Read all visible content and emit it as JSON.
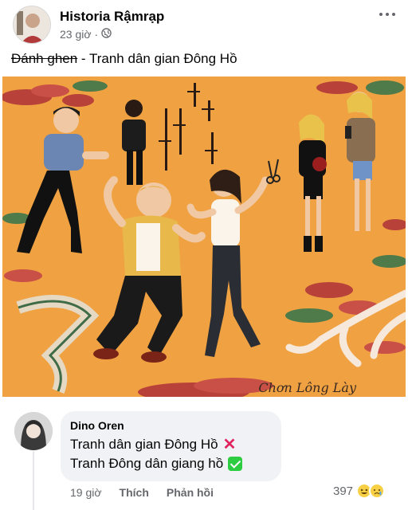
{
  "post": {
    "page_name": "Historia Rậmrạp",
    "time": "23 giờ",
    "audience_icon": "globe-icon",
    "more_icon": "more-options-icon",
    "caption_struck": "Đánh ghen",
    "caption_rest": " - Tranh dân gian Đông Hồ",
    "artwork": {
      "signature": "Chơn Lông Lày",
      "calligraphy_col1": "打從又相",
      "calligraphy_col2": "捉奸夕奸",
      "calligraphy_col3": "之調生事",
      "calligraphy_col4": "孫碩房屋"
    }
  },
  "comment": {
    "author": "Dino Oren",
    "line1": "Tranh dân gian Đông Hồ",
    "line1_icon": "cross-mark-icon",
    "line2": "Tranh Đông dân giang hồ",
    "line2_icon": "check-mark-icon",
    "time": "19 giờ",
    "like_label": "Thích",
    "reply_label": "Phản hồi",
    "reaction_count": "397",
    "reaction_icons": [
      "laughing-emoji-icon",
      "sad-emoji-icon"
    ]
  },
  "colors": {
    "background_orange": "#f0a243",
    "bubble": "#f0f2f5",
    "muted_text": "#65676b"
  }
}
